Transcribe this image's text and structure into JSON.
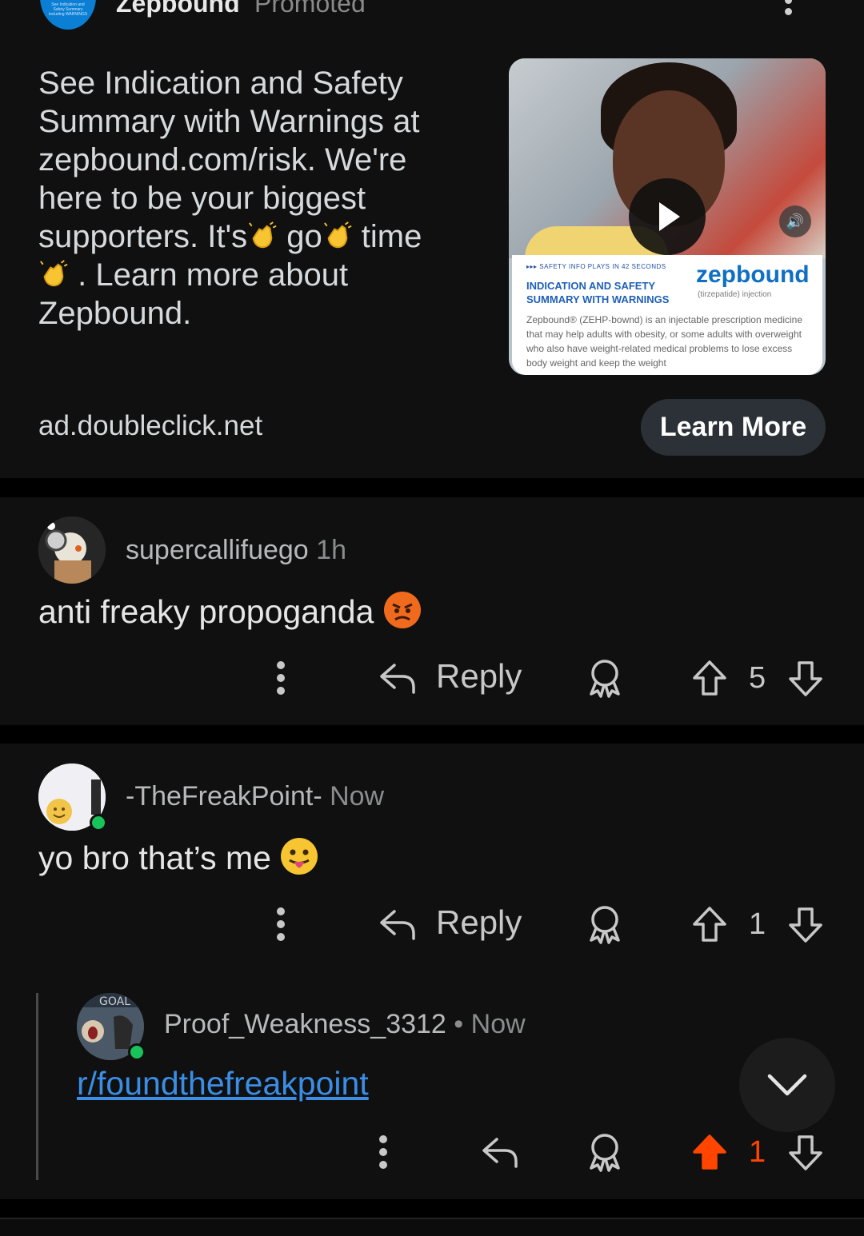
{
  "ad": {
    "advertiser": "Zepbound",
    "promoted_label": "Promoted",
    "avatar_text": "See Indication and Safety Summary including WARNINGS",
    "text_line1": "See Indication and Safety",
    "text_line2": "Summary with Warnings at",
    "text_line3": "zepbound.com/risk. We're",
    "text_line4": "here to be your biggest",
    "text_line5a": "supporters. It's",
    "text_line5b": " go",
    "text_line5c": " time",
    "text_line6": " . Learn more about",
    "text_line7": "Zepbound.",
    "media": {
      "info_strip": "▸▸▸ SAFETY INFO PLAYS IN 42 SECONDS",
      "panel_title": "INDICATION AND SAFETY SUMMARY WITH WARNINGS",
      "brand": "zepbound",
      "brand_sub": "(tirzepatide) injection",
      "panel_body": "Zepbound® (ZEHP-bownd) is an injectable prescription medicine that may help adults with obesity, or some adults with overweight who also have weight-related medical problems to lose excess body weight and keep the weight",
      "sound_label": "SOUND ON"
    },
    "domain": "ad.doubleclick.net",
    "cta": "Learn More"
  },
  "comments": [
    {
      "author": "supercallifuego",
      "time": "1h",
      "body": "anti freaky propoganda",
      "reply_label": "Reply",
      "score": "5"
    },
    {
      "author": "-TheFreakPoint-",
      "time": "Now",
      "body": "yo bro that’s me",
      "reply_label": "Reply",
      "score": "1"
    },
    {
      "author": "Proof_Weakness_3312",
      "separator": "•",
      "time": "Now",
      "body_link": "r/foundthefreakpoint",
      "score": "1"
    }
  ],
  "colors": {
    "background": "#000000",
    "card": "#101010",
    "upvoted": "#ff4500",
    "link": "#3a8ee6",
    "online": "#18c45a",
    "cta_bg": "#2b3136"
  },
  "icons": [
    "more-vertical-icon",
    "reply-icon",
    "award-icon",
    "upvote-icon",
    "downvote-icon",
    "chevron-down-icon",
    "play-icon",
    "sound-icon"
  ]
}
